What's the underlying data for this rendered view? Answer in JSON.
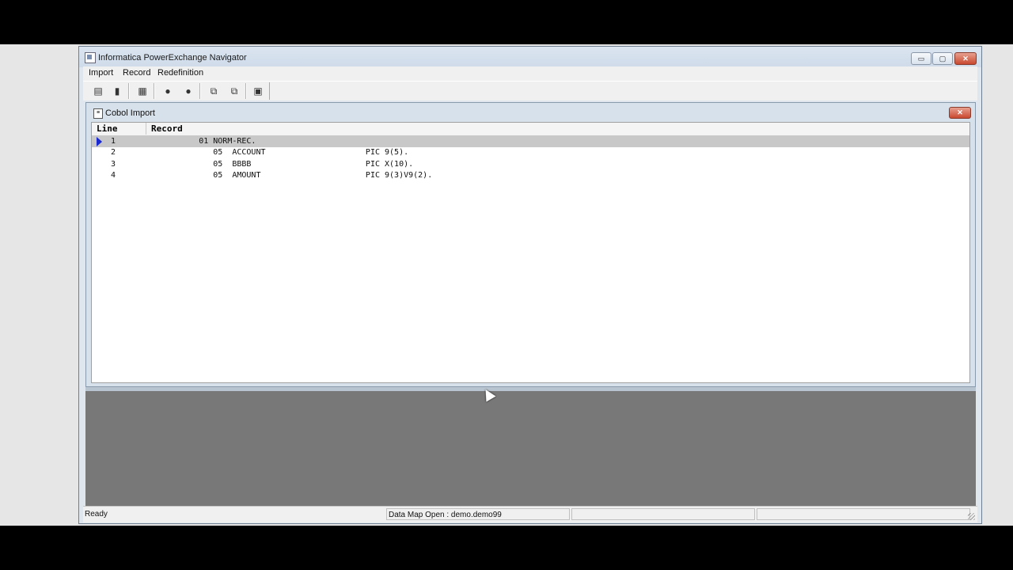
{
  "window": {
    "title": "Informatica PowerExchange Navigator",
    "controls": {
      "minimize": "▭",
      "maximize": "▢",
      "close": "✕"
    }
  },
  "menu": {
    "items": [
      "Import",
      "Record",
      "Redefinition"
    ]
  },
  "toolbar": {
    "icons": [
      "grid-view-icon",
      "record-icon",
      "import-icon",
      "comment-up-icon",
      "comment-down-icon",
      "copy-up-icon",
      "copy-down-icon",
      "properties-icon"
    ]
  },
  "child_window": {
    "title": "Cobol Import",
    "close": "✕"
  },
  "grid": {
    "columns": {
      "line": "Line",
      "record": "Record"
    },
    "rows": [
      {
        "line": "1",
        "record": "          01 NORM-REC."
      },
      {
        "line": "2",
        "record": "             05  ACCOUNT                     PIC 9(5)."
      },
      {
        "line": "3",
        "record": "             05  BBBB                        PIC X(10)."
      },
      {
        "line": "4",
        "record": "             05  AMOUNT                      PIC 9(3)V9(2)."
      }
    ],
    "selected_row": 1
  },
  "statusbar": {
    "status": "Ready",
    "data_map": "Data Map Open : demo.demo99",
    "cell3": "",
    "cell4": ""
  },
  "colors": {
    "titlebar": "#dbe5f1",
    "selected_row": "#c8c8c8",
    "empty_pane": "#787878",
    "close_button": "#c9482f"
  }
}
